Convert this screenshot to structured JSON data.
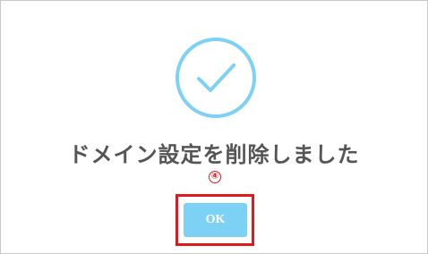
{
  "dialog": {
    "icon": "check-circle-icon",
    "message": "ドメイン設定を削除しました",
    "step_marker": "④",
    "ok_label": "OK"
  },
  "colors": {
    "accent": "#7dd1f4",
    "highlight": "#e0191e",
    "text": "#555555"
  }
}
